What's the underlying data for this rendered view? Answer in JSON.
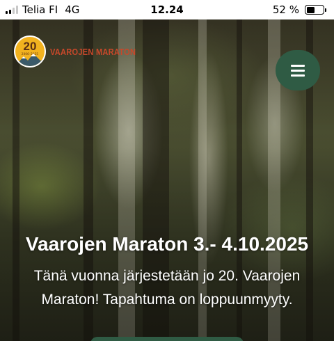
{
  "status_bar": {
    "carrier": "Telia FI",
    "network": "4G",
    "time": "12.24",
    "battery_percent": "52 %",
    "battery_level": 0.52,
    "signal_bars_active": 2
  },
  "header": {
    "logo": {
      "number": "20",
      "years": "2006–2025",
      "name": "VAAROJEN MARATON"
    },
    "menu_icon": "hamburger-icon"
  },
  "hero": {
    "title": "Vaarojen Maraton 3.- 4.10.2025",
    "text": "Tänä vuonna järjestetään jo 20. Vaarojen Maraton! Tapahtuma on loppuunmyyty."
  },
  "colors": {
    "menu_button": "#2f5b44",
    "logo_badge": "#f2b21f",
    "logo_text": "#c8482a"
  }
}
